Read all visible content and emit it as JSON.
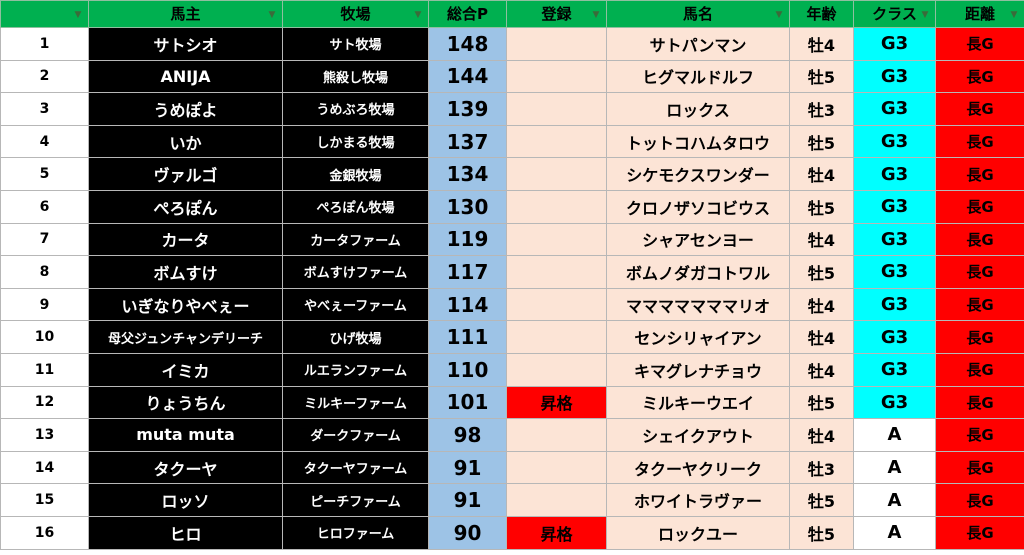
{
  "colors": {
    "header": "#00b050",
    "owner_bg": "#000000",
    "points_bg": "#9dc3e6",
    "row_bg": "#fce4d6",
    "promo": "#ff0000",
    "g3": "#00ffff",
    "class_a": "#ffffff",
    "distance": "#ff0000"
  },
  "headers": {
    "owner": "馬主",
    "ranch": "牧場",
    "points": "総合P",
    "registration": "登録",
    "horse": "馬名",
    "age": "年齢",
    "class": "クラス",
    "distance": "距離"
  },
  "rows": [
    {
      "no": "1",
      "owner": "サトシオ",
      "ranch": "サト牧場",
      "points": "148",
      "reg": "",
      "horse": "サトパンマン",
      "age": "牡4",
      "cls": "G3",
      "dist": "長G"
    },
    {
      "no": "2",
      "owner": "ANIJA",
      "ranch": "熊殺し牧場",
      "points": "144",
      "reg": "",
      "horse": "ヒグマルドルフ",
      "age": "牡5",
      "cls": "G3",
      "dist": "長G"
    },
    {
      "no": "3",
      "owner": "うめぽよ",
      "ranch": "うめぶろ牧場",
      "points": "139",
      "reg": "",
      "horse": "ロックス",
      "age": "牡3",
      "cls": "G3",
      "dist": "長G"
    },
    {
      "no": "4",
      "owner": "いか",
      "ranch": "しかまる牧場",
      "points": "137",
      "reg": "",
      "horse": "トットコハムタロウ",
      "age": "牡5",
      "cls": "G3",
      "dist": "長G"
    },
    {
      "no": "5",
      "owner": "ヴァルゴ",
      "ranch": "金銀牧場",
      "points": "134",
      "reg": "",
      "horse": "シケモクスワンダー",
      "age": "牡4",
      "cls": "G3",
      "dist": "長G"
    },
    {
      "no": "6",
      "owner": "ぺろぽん",
      "ranch": "ぺろぽん牧場",
      "points": "130",
      "reg": "",
      "horse": "クロノザソコビウス",
      "age": "牡5",
      "cls": "G3",
      "dist": "長G"
    },
    {
      "no": "7",
      "owner": "カータ",
      "ranch": "カータファーム",
      "points": "119",
      "reg": "",
      "horse": "シャアセンヨー",
      "age": "牡4",
      "cls": "G3",
      "dist": "長G"
    },
    {
      "no": "8",
      "owner": "ボムすけ",
      "ranch": "ボムすけファーム",
      "points": "117",
      "reg": "",
      "horse": "ボムノダガコトワル",
      "age": "牡5",
      "cls": "G3",
      "dist": "長G"
    },
    {
      "no": "9",
      "owner": "いぎなりやべぇー",
      "ranch": "やべぇーファーム",
      "points": "114",
      "reg": "",
      "horse": "マママママママリオ",
      "age": "牡4",
      "cls": "G3",
      "dist": "長G"
    },
    {
      "no": "10",
      "owner": "母父ジュンチャンデリーチ",
      "ranch": "ひげ牧場",
      "points": "111",
      "reg": "",
      "horse": "センシリャイアン",
      "age": "牡4",
      "cls": "G3",
      "dist": "長G"
    },
    {
      "no": "11",
      "owner": "イミカ",
      "ranch": "ルエランファーム",
      "points": "110",
      "reg": "",
      "horse": "キマグレナチョウ",
      "age": "牡4",
      "cls": "G3",
      "dist": "長G"
    },
    {
      "no": "12",
      "owner": "りょうちん",
      "ranch": "ミルキーファーム",
      "points": "101",
      "reg": "昇格",
      "horse": "ミルキーウエイ",
      "age": "牡5",
      "cls": "G3",
      "dist": "長G"
    },
    {
      "no": "13",
      "owner": "muta muta",
      "ranch": "ダークファーム",
      "points": "98",
      "reg": "",
      "horse": "シェイクアウト",
      "age": "牡4",
      "cls": "A",
      "dist": "長G"
    },
    {
      "no": "14",
      "owner": "タクーヤ",
      "ranch": "タクーヤファーム",
      "points": "91",
      "reg": "",
      "horse": "タクーヤクリーク",
      "age": "牡3",
      "cls": "A",
      "dist": "長G"
    },
    {
      "no": "15",
      "owner": "ロッソ",
      "ranch": "ピーチファーム",
      "points": "91",
      "reg": "",
      "horse": "ホワイトラヴァー",
      "age": "牡5",
      "cls": "A",
      "dist": "長G"
    },
    {
      "no": "16",
      "owner": "ヒロ",
      "ranch": "ヒロファーム",
      "points": "90",
      "reg": "昇格",
      "horse": "ロックユー",
      "age": "牡5",
      "cls": "A",
      "dist": "長G"
    }
  ]
}
